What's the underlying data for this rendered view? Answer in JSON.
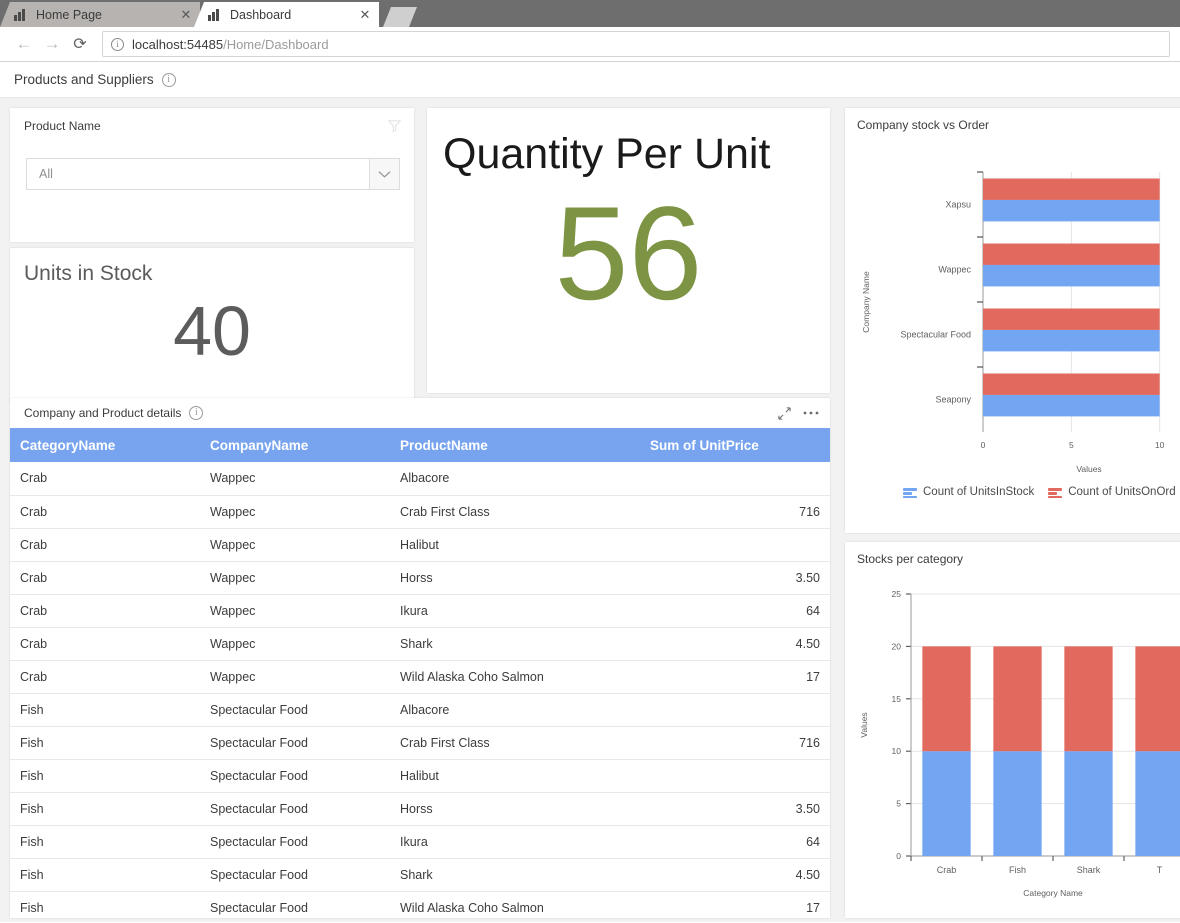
{
  "browser": {
    "tabs": [
      {
        "title": "Home Page",
        "favicon": "bar-chart-icon",
        "active": false,
        "close_label": "✕"
      },
      {
        "title": "Dashboard",
        "favicon": "bar-chart-icon",
        "active": true,
        "close_label": "✕"
      }
    ],
    "nav": {
      "back": "←",
      "forward": "→",
      "reload": "⟳"
    },
    "omnibox": {
      "info_glyph": "i",
      "host": "localhost:54485",
      "path": "/Home/Dashboard"
    }
  },
  "page": {
    "title": "Products and Suppliers",
    "info_glyph": "i"
  },
  "slicer": {
    "label": "Product Name",
    "filter_icon": "funnel-icon",
    "value": "All",
    "placeholder": "All"
  },
  "kpi_units_in_stock": {
    "title": "Units in Stock",
    "value": "40",
    "color": "#5c5c5c"
  },
  "kpi_quantity_per_unit": {
    "title": "Quantity Per Unit",
    "value": "56",
    "color": "#7d9445"
  },
  "table": {
    "title": "Company and Product details",
    "info_glyph": "i",
    "focus_icon": "expand-diagonal-icon",
    "menu_icon": "ellipsis-icon",
    "columns": [
      "CategoryName",
      "CompanyName",
      "ProductName",
      "Sum of UnitPrice"
    ],
    "header_color": "#78a4ef",
    "rows": [
      [
        "Crab",
        "Wappec",
        "Albacore",
        ""
      ],
      [
        "Crab",
        "Wappec",
        "Crab First Class",
        "716"
      ],
      [
        "Crab",
        "Wappec",
        "Halibut",
        ""
      ],
      [
        "Crab",
        "Wappec",
        "Horss",
        "3.50"
      ],
      [
        "Crab",
        "Wappec",
        "Ikura",
        "64"
      ],
      [
        "Crab",
        "Wappec",
        "Shark",
        "4.50"
      ],
      [
        "Crab",
        "Wappec",
        "Wild Alaska Coho Salmon",
        "17"
      ],
      [
        "Fish",
        "Spectacular Food",
        "Albacore",
        ""
      ],
      [
        "Fish",
        "Spectacular Food",
        "Crab First Class",
        "716"
      ],
      [
        "Fish",
        "Spectacular Food",
        "Halibut",
        ""
      ],
      [
        "Fish",
        "Spectacular Food",
        "Horss",
        "3.50"
      ],
      [
        "Fish",
        "Spectacular Food",
        "Ikura",
        "64"
      ],
      [
        "Fish",
        "Spectacular Food",
        "Shark",
        "4.50"
      ],
      [
        "Fish",
        "Spectacular Food",
        "Wild Alaska Coho Salmon",
        "17"
      ]
    ]
  },
  "chart_data": [
    {
      "id": "company-stock-vs-order",
      "type": "bar",
      "title": "Company stock vs Order",
      "xlabel": "Values",
      "ylabel": "Company Name",
      "categories": [
        "Xapsu",
        "Wappec",
        "Spectacular Food",
        "Seapony"
      ],
      "series": [
        {
          "name": "Count of UnitsInStock",
          "color": "#72a5f2",
          "values": [
            10,
            10,
            10,
            10
          ]
        },
        {
          "name": "Count of UnitsOnOrder",
          "color": "#e2695d",
          "values": [
            10,
            10,
            10,
            10
          ]
        }
      ],
      "legend": [
        "Count of UnitsInStock",
        "Count of UnitsOnOrd"
      ],
      "legend_position": "bottom",
      "xlim": [
        0,
        12
      ],
      "xticks": [
        "0",
        "5",
        "10"
      ],
      "grid": true
    },
    {
      "id": "stocks-per-category",
      "type": "bar",
      "stacked": true,
      "title": "Stocks per category",
      "xlabel": "Category Name",
      "ylabel": "Values",
      "categories": [
        "Crab",
        "Fish",
        "Shark",
        "T"
      ],
      "series": [
        {
          "name": "Count of UnitsInStock",
          "color": "#72a5f2",
          "values": [
            10,
            10,
            10,
            10
          ]
        },
        {
          "name": "Count of UnitsOnOrder",
          "color": "#e2695d",
          "values": [
            10,
            10,
            10,
            10
          ]
        }
      ],
      "ylim": [
        0,
        25
      ],
      "yticks": [
        "0",
        "5",
        "10",
        "15",
        "20",
        "25"
      ],
      "grid": true
    }
  ]
}
